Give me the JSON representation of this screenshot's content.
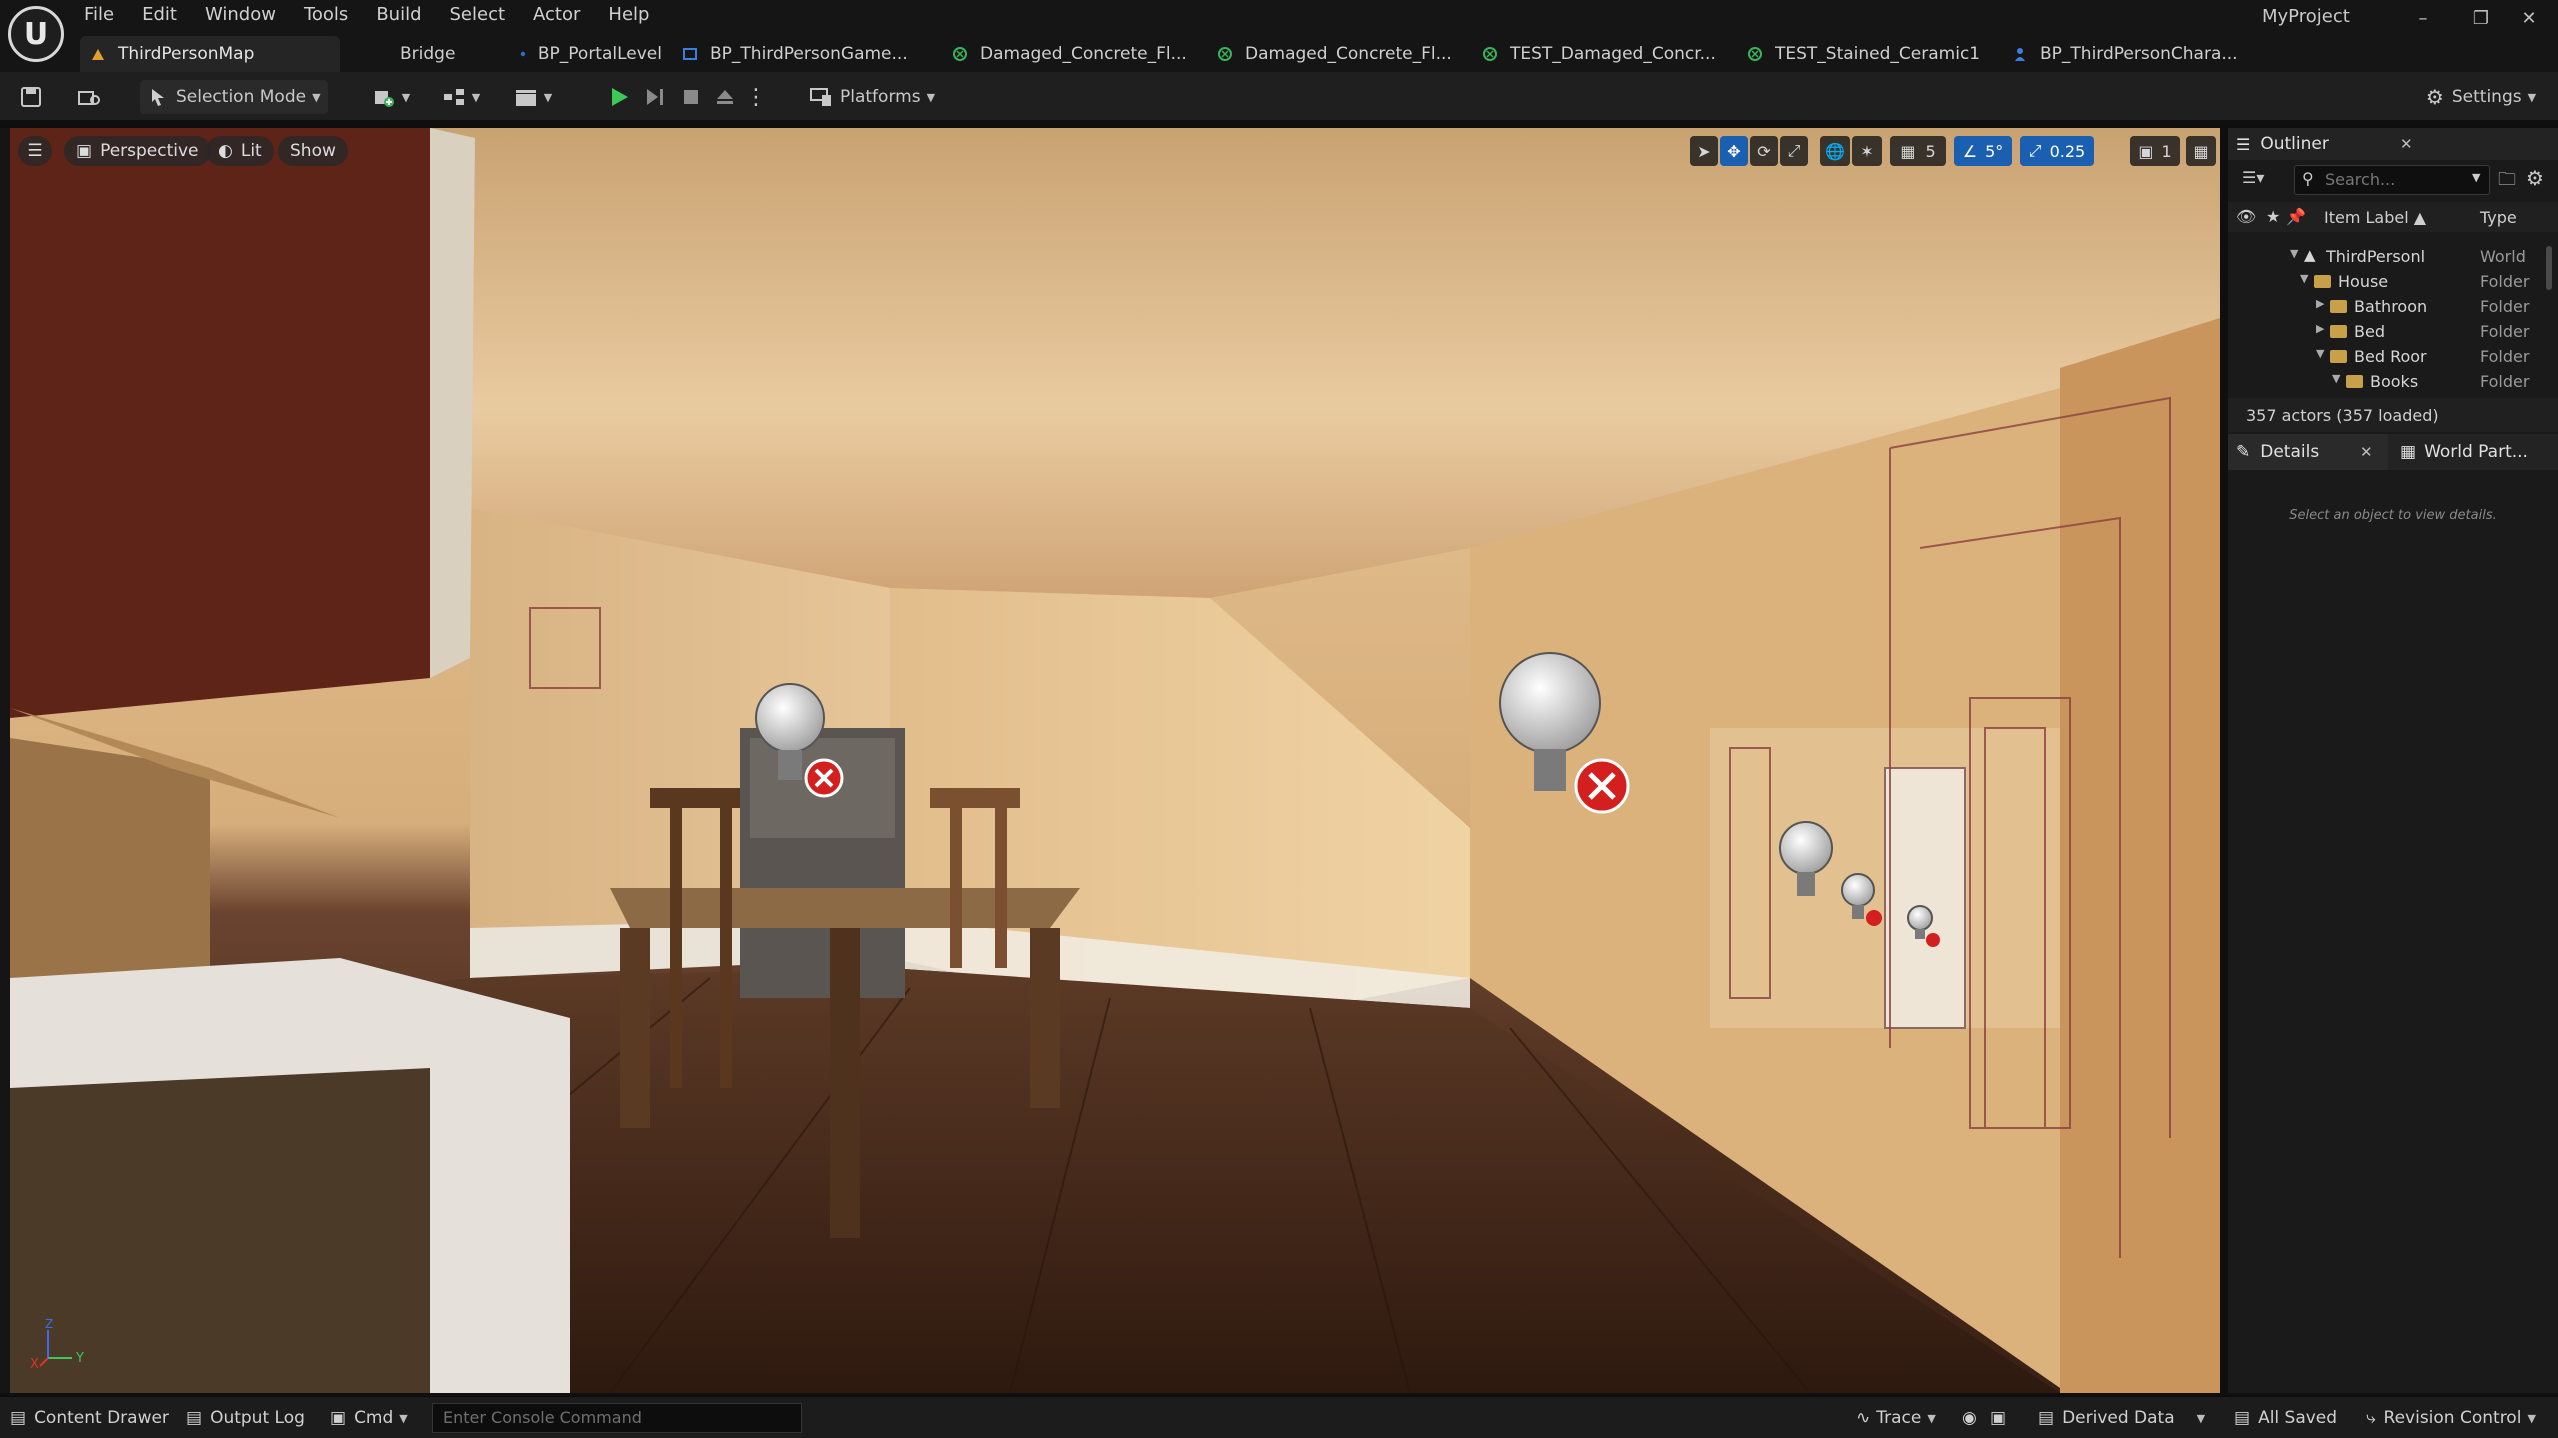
{
  "app": {
    "project_name": "MyProject",
    "logo_glyph": "U"
  },
  "menu": [
    "File",
    "Edit",
    "Window",
    "Tools",
    "Build",
    "Select",
    "Actor",
    "Help"
  ],
  "tabs": [
    {
      "label": "ThirdPersonMap",
      "icon": "level-icon",
      "active": true
    },
    {
      "label": "Bridge",
      "icon": "",
      "active": false
    },
    {
      "label": "BP_PortalLevel",
      "icon": "blueprint-icon",
      "active": false
    },
    {
      "label": "BP_ThirdPersonGame...",
      "icon": "blueprint-icon",
      "active": false
    },
    {
      "label": "Damaged_Concrete_Fl...",
      "icon": "material-icon",
      "active": false
    },
    {
      "label": "Damaged_Concrete_Fl...",
      "icon": "material-icon",
      "active": false
    },
    {
      "label": "TEST_Damaged_Concr...",
      "icon": "material-icon",
      "active": false
    },
    {
      "label": "TEST_Stained_Ceramic1",
      "icon": "material-icon",
      "active": false
    },
    {
      "label": "BP_ThirdPersonChara...",
      "icon": "character-icon",
      "active": false
    }
  ],
  "toolbar": {
    "selection_mode": "Selection Mode",
    "platforms": "Platforms",
    "settings": "Settings"
  },
  "viewport": {
    "perspective": "Perspective",
    "lit": "Lit",
    "show": "Show",
    "grid_snap": "5",
    "rotation_snap": "5°",
    "scale_snap": "0.25",
    "camera_speed": "1",
    "axis_x": "X",
    "axis_y": "Y",
    "axis_z": "Z"
  },
  "outliner": {
    "title": "Outliner",
    "search_placeholder": "Search...",
    "col_label": "Item Label ▲",
    "col_type": "Type",
    "rows": [
      {
        "name": "ThirdPersonl",
        "type": "World",
        "indent": 0
      },
      {
        "name": "House",
        "type": "Folder",
        "indent": 1
      },
      {
        "name": "Bathroon",
        "type": "Folder",
        "indent": 2
      },
      {
        "name": "Bed",
        "type": "Folder",
        "indent": 2
      },
      {
        "name": "Bed Roor",
        "type": "Folder",
        "indent": 2
      },
      {
        "name": "Books",
        "type": "Folder",
        "indent": 3
      }
    ],
    "actor_count": "357 actors (357 loaded)"
  },
  "details": {
    "title": "Details",
    "world_partition_tab": "World Part...",
    "empty_message": "Select an object to view details."
  },
  "statusbar": {
    "content_drawer": "Content Drawer",
    "output_log": "Output Log",
    "cmd": "Cmd",
    "console_placeholder": "Enter Console Command",
    "trace": "Trace",
    "derived_data": "Derived Data",
    "all_saved": "All Saved",
    "revision_control": "Revision Control"
  }
}
